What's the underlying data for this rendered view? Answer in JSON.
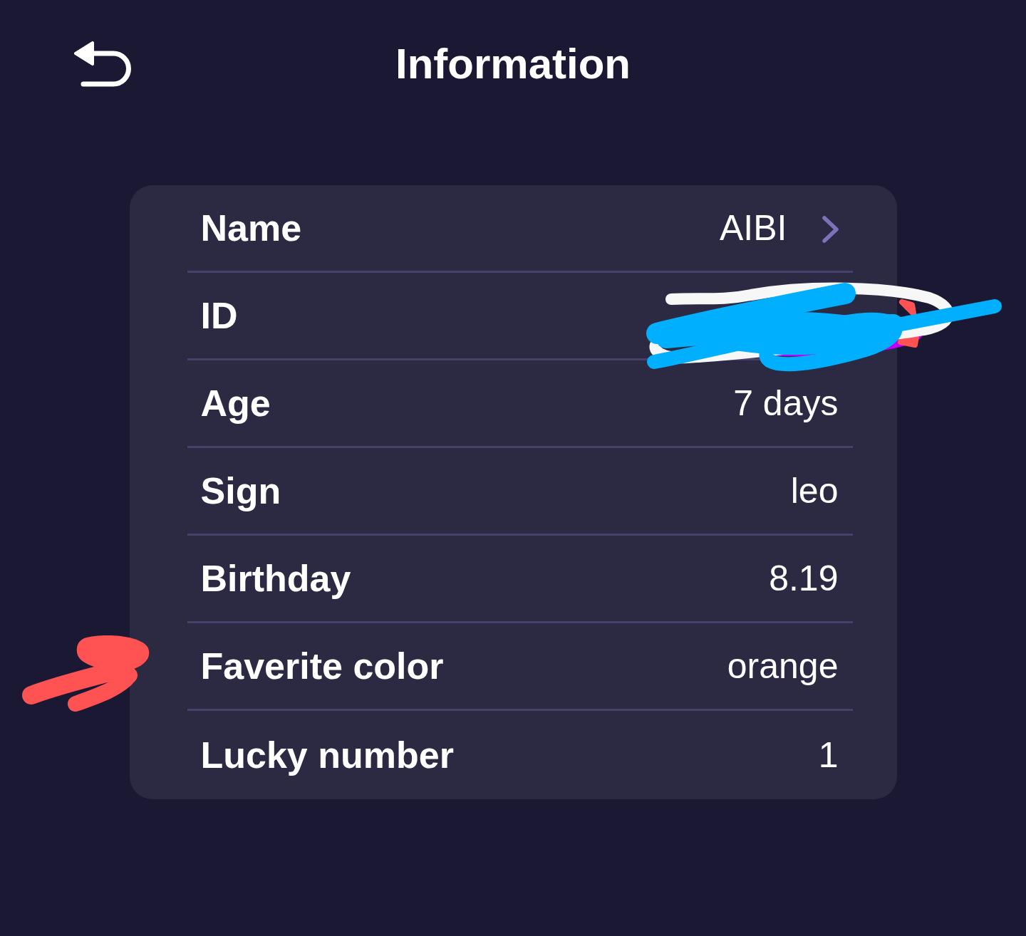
{
  "header": {
    "title": "Information"
  },
  "info": {
    "rows": [
      {
        "label": "Name",
        "value": "AIBI",
        "kind": "link"
      },
      {
        "label": "ID",
        "kind": "plain"
      },
      {
        "label": "Age",
        "value": "7 days",
        "kind": "plain"
      },
      {
        "label": "Sign",
        "value": "leo",
        "kind": "plain"
      },
      {
        "label": "Birthday",
        "value": "8.19",
        "kind": "plain"
      },
      {
        "label": "Faverite color",
        "value": "orange",
        "kind": "plain"
      },
      {
        "label": "Lucky number",
        "value": "1",
        "kind": "plain"
      }
    ]
  }
}
